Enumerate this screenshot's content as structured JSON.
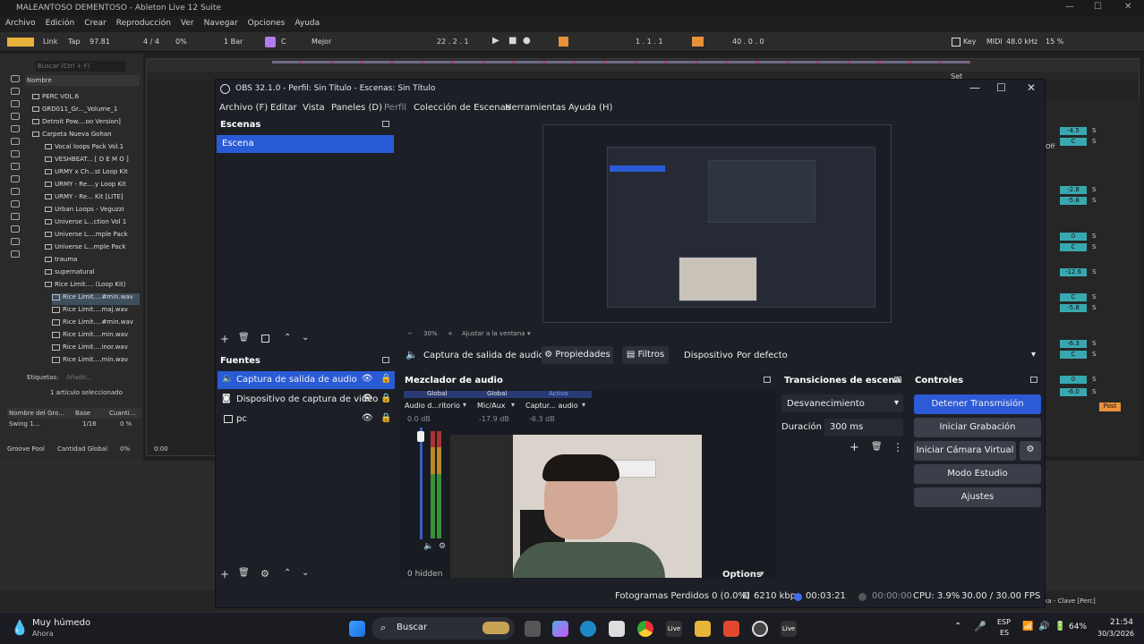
{
  "ableton": {
    "title": "MALEANTOSO DEMENTOSO - Ableton Live 12 Suite",
    "menu": [
      "Archivo",
      "Edición",
      "Crear",
      "Reproducción",
      "Ver",
      "Navegar",
      "Opciones",
      "Ayuda"
    ],
    "control": {
      "link": "Link",
      "tap": "Tap",
      "tempo": "97.81",
      "timesig": "4 / 4",
      "cpu_pct": "0%",
      "quant": "1 Bar",
      "key": "C",
      "mode": "Mejor",
      "position": "22 .  2 .  1",
      "loop_start": "1 .  1 .  1",
      "loop_len": "40 .  0 .  0",
      "key_btn": "Key",
      "midi": "MIDI",
      "sample_rate": "48.0 kHz",
      "cpu_load": "15 %"
    },
    "browser": {
      "search_placeholder": "Buscar (Ctrl + F)",
      "name_header": "Nombre",
      "items": [
        "PERC VOL.6",
        "GRD011_Gr..._Volume_1",
        "Detroit Pow....oo Version]",
        "Carpeta Nueva Gohan",
        "Vocal loops Pack Vol.1",
        "VESHBEAT... [ D E M O ]",
        "URMY x Ch...st Loop Kit",
        "URMY - Re....y Loop Kit",
        "URMY - Re... Kit [LITE]",
        "Urban Loops - Veguzzi",
        "Universe L...ction Vol 1",
        "Universe L....mple Pack",
        "Universe L...mple Pack",
        "trauma",
        "supernatural",
        "Rice Limit.... (Loop Kit)"
      ],
      "files": [
        "Rice Limit....#min.wav",
        "Rice Limit....maj.wav",
        "Rice Limit....#min.wav",
        "Rice Limit....min.wav",
        "Rice Limit....inor.wav",
        "Rice Limit....min.wav"
      ],
      "tags_label": "Etiquetas:",
      "tags_add": "Añadir...",
      "selected": "1 artículo seleccionado"
    },
    "groove": {
      "name_col": "Nombre del Gro...",
      "base_col": "Base",
      "quant_col": "Cuantí...",
      "item": "Swing 1...",
      "base": "1/16",
      "quant": "0 %",
      "pool": "Groove Pool",
      "global": "Cantidad Global",
      "global_val": "0%"
    },
    "arr_time": "0:00",
    "set_label": "Set",
    "mixer_values": [
      "-4.5",
      "C",
      "-2.8",
      "-5.8",
      "0",
      "C",
      "-12.6",
      "C",
      "-5.8",
      "-6.3",
      "C",
      "0",
      "-6.0"
    ],
    "mixer_post": "Post",
    "off": "Off",
    "status_right": "nka - Clave [Perc]"
  },
  "obs": {
    "title": "OBS 32.1.0 - Perfil: Sin Título - Escenas: Sin Título",
    "menu": [
      "Archivo (F)",
      "Editar",
      "Vista",
      "Paneles (D)",
      "Perfil",
      "Colección de Escenas",
      "Herramientas",
      "Ayuda (H)"
    ],
    "scenes": {
      "header": "Escenas",
      "items": [
        "Escena"
      ]
    },
    "sources": {
      "header": "Fuentes",
      "items": [
        "Captura de salida de audio",
        "Dispositivo de captura de video",
        "pc"
      ]
    },
    "preview": {
      "zoom": "30%",
      "fit": "Ajustar a la ventana"
    },
    "context": {
      "source": "Captura de salida de audio",
      "props": "Propiedades",
      "filters": "Filtros",
      "device_label": "Dispositivo",
      "device_value": "Por defecto"
    },
    "mixer": {
      "header": "Mezclador de audio",
      "tags": [
        "Global",
        "Global",
        "Activo"
      ],
      "channels": [
        "Audio d...ritorio",
        "Mic/Aux",
        "Captur... audio"
      ],
      "db": [
        "0.0 dB",
        "-17.9 dB",
        "-6.3 dB"
      ],
      "hidden": "0 hidden",
      "options": "Options"
    },
    "transitions": {
      "header": "Transiciones de escena",
      "type": "Desvanecimiento",
      "duration_label": "Duración",
      "duration": "300 ms"
    },
    "controls": {
      "header": "Controles",
      "stream": "Detener Transmisión",
      "record": "Iniciar Grabación",
      "virtualcam": "Iniciar Cámara Virtual",
      "studio": "Modo Estudio",
      "settings": "Ajustes"
    },
    "status": {
      "dropped": "Fotogramas Perdidos 0 (0.0%)",
      "bitrate": "6210 kbps",
      "stream_time": "00:03:21",
      "rec_time": "00:00:00",
      "cpu": "CPU: 3.9%",
      "fps": "30.00 / 30.00 FPS"
    }
  },
  "taskbar": {
    "weather": "Muy húmedo",
    "weather_sub": "Ahora",
    "search": "Buscar",
    "lang": "ESP",
    "lang2": "ES",
    "battery": "64%",
    "time": "21:54",
    "date": "30/3/2026"
  }
}
